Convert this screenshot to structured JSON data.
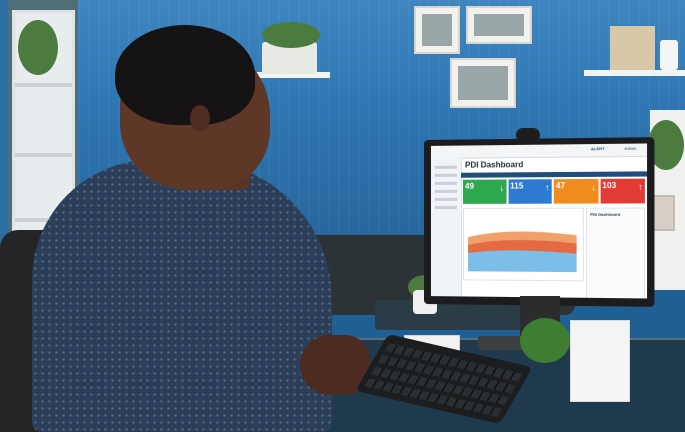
{
  "screen": {
    "brand": "ALERT",
    "user": "Admin",
    "title": "PDI Dashboard",
    "tiles": [
      {
        "value": "49",
        "arrow": "↓",
        "color": "#2ea84f"
      },
      {
        "value": "115",
        "arrow": "↑",
        "color": "#2c7bd0"
      },
      {
        "value": "47",
        "arrow": "↓",
        "color": "#f08c1d"
      },
      {
        "value": "103",
        "arrow": "↑",
        "color": "#e23a35"
      }
    ],
    "chart_caption": "PDI Dashboard",
    "side_title": "PDI Dashboard"
  }
}
